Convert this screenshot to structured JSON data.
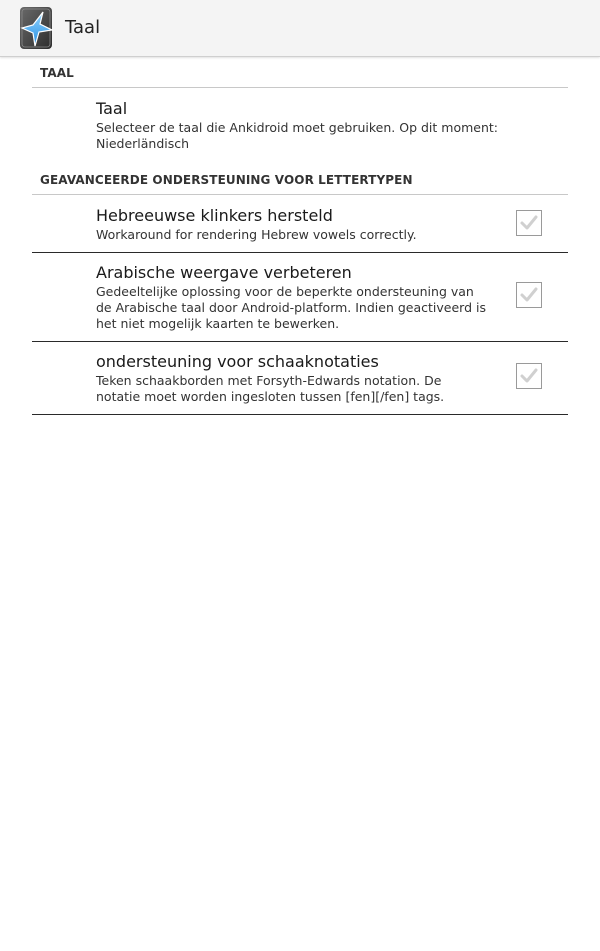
{
  "actionbar": {
    "title": "Taal",
    "icon": "ankidroid-star-card-icon"
  },
  "sections": [
    {
      "header": "TAAL",
      "items": [
        {
          "title": "Taal",
          "summary": "Selecteer de taal die Ankidroid moet gebruiken. Op dit moment: Niederländisch"
        }
      ]
    },
    {
      "header": "GEAVANCEERDE ONDERSTEUNING VOOR LETTERTYPEN",
      "items": [
        {
          "title": "Hebreeuwse klinkers hersteld",
          "summary": "Workaround for rendering Hebrew vowels correctly.",
          "checked": false
        },
        {
          "title": "Arabische weergave verbeteren",
          "summary": "Gedeeltelijke oplossing voor de beperkte ondersteuning van de Arabische taal door Android-platform. Indien geactiveerd is het niet mogelijk kaarten te bewerken.",
          "checked": false
        },
        {
          "title": "ondersteuning voor schaaknotaties",
          "summary": "Teken schaakborden met Forsyth-Edwards notation. De notatie moet worden ingesloten tussen [fen][/fen] tags.",
          "checked": false
        }
      ]
    }
  ],
  "colors": {
    "actionbar_bg": "#f4f4f4",
    "divider_dark": "#2a2a2a",
    "divider_light": "#c8c8c8",
    "checkbox_border": "#9a9a9a",
    "checkmark_unchecked": "#d0d0d0"
  }
}
